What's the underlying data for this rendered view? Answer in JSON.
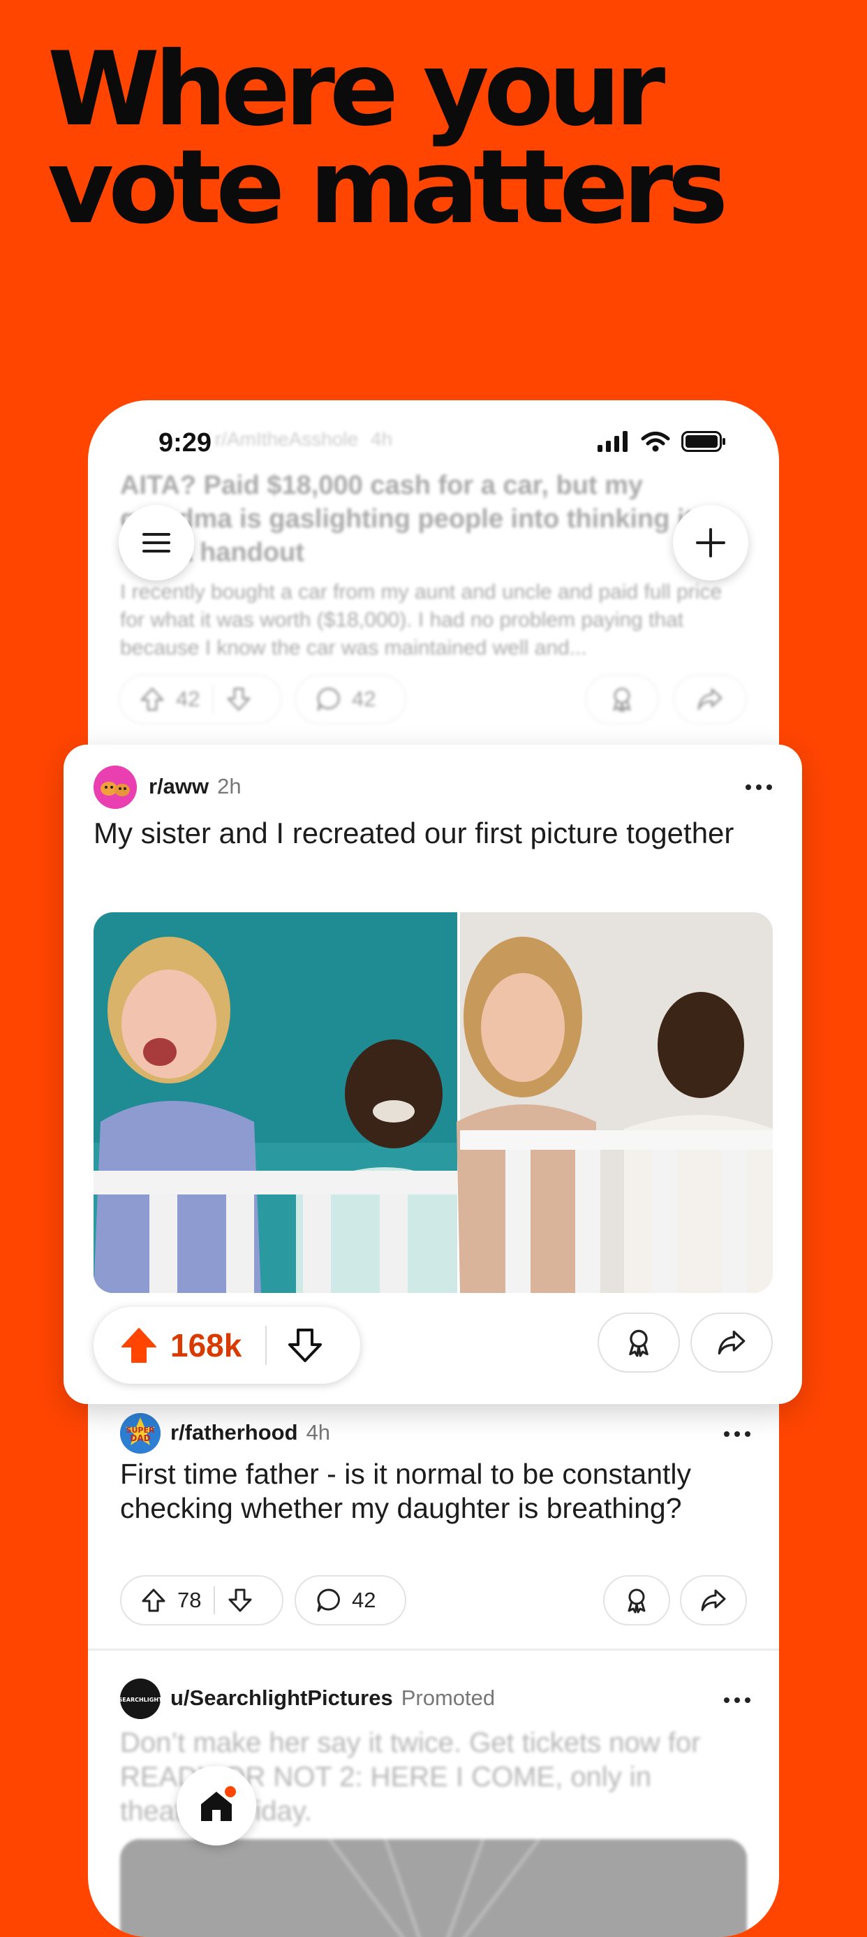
{
  "headline": {
    "line1": "Where your",
    "line2": "vote matters"
  },
  "status_bar": {
    "time": "9:29"
  },
  "background_post": {
    "subreddit": "r/AmItheAsshole",
    "time": "4h",
    "title": "AITA? Paid $18,000 cash for a car, but my grandma is gaslighting people into thinking it was a handout",
    "body": "I recently bought a car from my aunt and uncle and paid full price for what it was worth ($18,000). I had no problem paying that because I know the car was maintained well and...",
    "votes": "42",
    "comments": "42"
  },
  "featured_post": {
    "subreddit": "r/aww",
    "time": "2h",
    "title": "My sister and I recreated our first picture together",
    "votes": "168k",
    "colors": {
      "upvote": "#FF4500",
      "count": "#D93A00",
      "photo_left_bg": "#1E8C92",
      "photo_right_bg": "#E4E0DC"
    }
  },
  "post_three": {
    "subreddit": "r/fatherhood",
    "time": "4h",
    "title": "First time father - is it normal to be constantly checking whether my daughter is breathing?",
    "votes": "78",
    "comments": "42",
    "avatar_text": "SUPER DAD"
  },
  "promoted_post": {
    "user": "u/SearchlightPictures",
    "tag": "Promoted",
    "title": "Don’t make her say it twice. Get tickets now for READY OR NOT 2: HERE I COME, only in theaters Friday.",
    "avatar_text": "SEARCHLIGHT"
  },
  "icons": [
    "menu-icon",
    "plus-icon",
    "upvote-icon",
    "downvote-icon",
    "comment-icon",
    "award-icon",
    "share-icon",
    "more-icon",
    "home-icon",
    "signal-icon",
    "wifi-icon",
    "battery-icon"
  ]
}
